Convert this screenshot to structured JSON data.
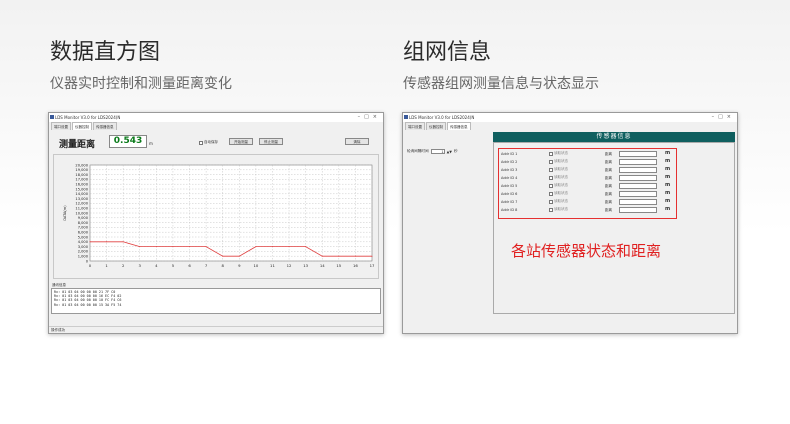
{
  "left": {
    "title": "数据直方图",
    "subtitle": "仪器实时控制和测量距离变化",
    "window": {
      "title": "LDS Monitor V3.0 for LDS2024(N",
      "tabs": [
        "端口设置",
        "仪器控制",
        "传感器信息"
      ],
      "active_tab": 1,
      "measure_label": "测量距离",
      "measure_value": "0.543",
      "measure_unit": "m",
      "auto_save_label": "自动保存",
      "start_label": "开始测量",
      "stop_label": "停止测量",
      "clear_label": "清除",
      "log_title": "通讯信息",
      "log_lines": [
        "Rx: 01 03 04 00 00 00 21 7F C0",
        "Rx: 01 03 04 00 00 00 16 EC F4 02",
        "Rx: 01 03 04 00 00 00 10 FC F4 C6",
        "Rx: 01 03 04 00 00 00 15 3A F5 74"
      ],
      "status": "操作成功"
    }
  },
  "right": {
    "title": "组网信息",
    "subtitle": "传感器组网测量信息与状态显示",
    "window": {
      "title": "LDS Monitor V3.0 for LDS2024(N",
      "tabs": [
        "端口设置",
        "仪器控制",
        "传感器信息"
      ],
      "active_tab": 2,
      "panel_title": "传感器信息",
      "interval_label": "轮询间隔时间",
      "interval_value": "1",
      "interval_unit": "秒",
      "sensor_rows": [
        {
          "id": "Addr ID 1",
          "check": "读取状态",
          "dist_label": "距离",
          "unit": "m"
        },
        {
          "id": "Addr ID 2",
          "check": "读取状态",
          "dist_label": "距离",
          "unit": "m"
        },
        {
          "id": "Addr ID 3",
          "check": "读取状态",
          "dist_label": "距离",
          "unit": "m"
        },
        {
          "id": "Addr ID 4",
          "check": "读取状态",
          "dist_label": "距离",
          "unit": "m"
        },
        {
          "id": "Addr ID 5",
          "check": "读取状态",
          "dist_label": "距离",
          "unit": "m"
        },
        {
          "id": "Addr ID 6",
          "check": "读取状态",
          "dist_label": "距离",
          "unit": "m"
        },
        {
          "id": "Addr ID 7",
          "check": "读取状态",
          "dist_label": "距离",
          "unit": "m"
        },
        {
          "id": "Addr ID 8",
          "check": "读取状态",
          "dist_label": "距离",
          "unit": "m"
        }
      ],
      "annotation": "各站传感器状态和距离"
    }
  },
  "chart_data": {
    "type": "line",
    "ylabel": "DATA(m)",
    "ylim": [
      0,
      20000
    ],
    "yticks": [
      "0",
      "1,000",
      "2,000",
      "3,000",
      "4,000",
      "5,000",
      "6,000",
      "7,000",
      "8,000",
      "9,000",
      "10,000",
      "11,000",
      "12,000",
      "13,000",
      "14,000",
      "15,000",
      "16,000",
      "17,000",
      "18,000",
      "19,000",
      "20,000"
    ],
    "xlim": [
      0,
      17
    ],
    "xticks": [
      "0",
      "1",
      "2",
      "3",
      "4",
      "5",
      "6",
      "7",
      "8",
      "9",
      "10",
      "11",
      "12",
      "13",
      "14",
      "15",
      "16",
      "17"
    ],
    "line_color": "#e04040",
    "series": [
      {
        "x": [
          0,
          1,
          2,
          3,
          4,
          5,
          6,
          7,
          8,
          9,
          10,
          11,
          12,
          13,
          14,
          15,
          16,
          17
        ],
        "values": [
          4000,
          4000,
          4000,
          3000,
          3000,
          3000,
          3000,
          3000,
          1000,
          1000,
          3000,
          3000,
          3000,
          3000,
          1000,
          1000,
          1000,
          1000
        ]
      }
    ]
  }
}
